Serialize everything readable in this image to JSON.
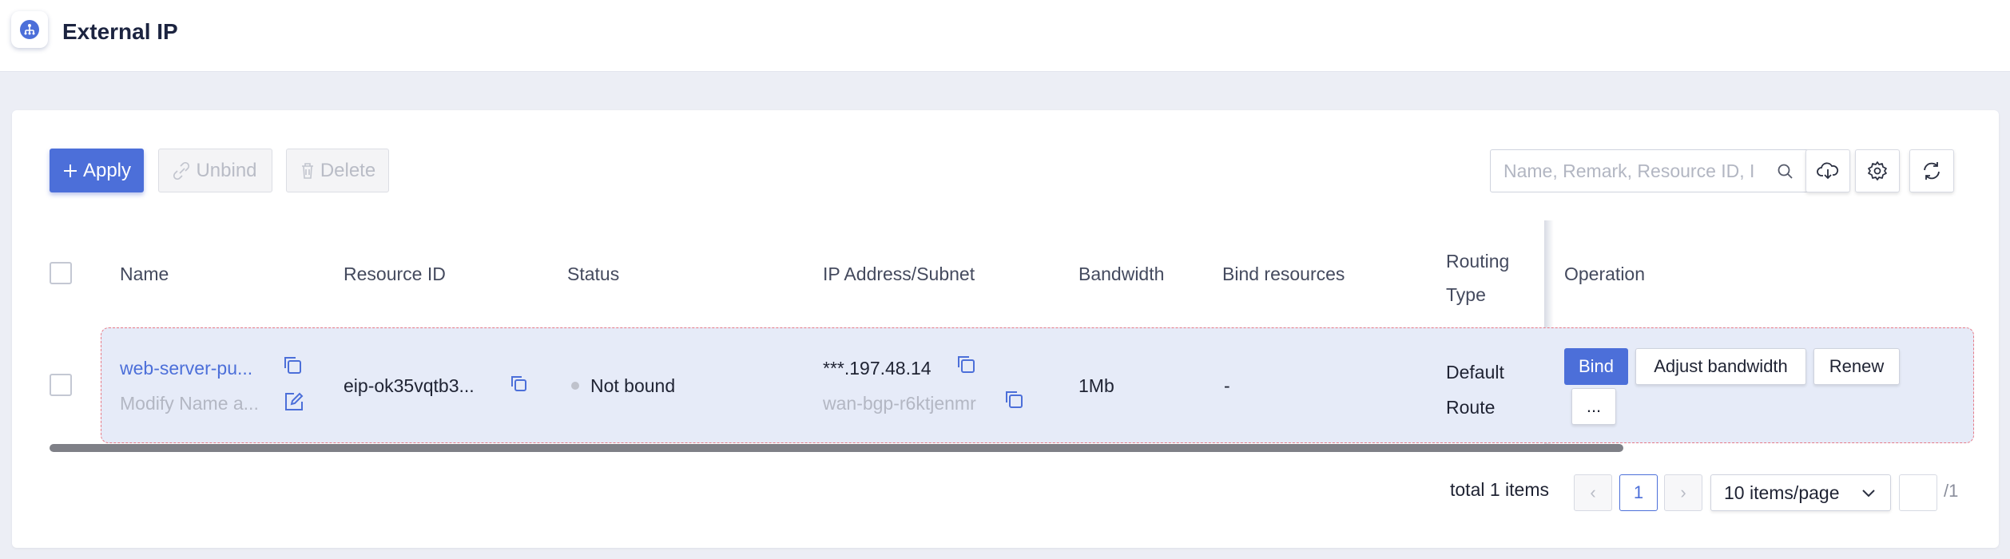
{
  "header": {
    "title": "External IP",
    "logo_icon": "network-icon"
  },
  "toolbar": {
    "apply_label": "Apply",
    "unbind_label": "Unbind",
    "delete_label": "Delete",
    "search_placeholder": "Name, Remark, Resource ID, I",
    "download_icon": "cloud-download-icon",
    "settings_icon": "gear-icon",
    "refresh_icon": "refresh-icon"
  },
  "table": {
    "columns": {
      "name": "Name",
      "resource_id": "Resource ID",
      "status": "Status",
      "ip": "IP Address/Subnet",
      "bandwidth": "Bandwidth",
      "bind": "Bind resources",
      "routing_line1": "Routing",
      "routing_line2": "Type",
      "operation": "Operation"
    },
    "rows": [
      {
        "name": "web-server-pu...",
        "remark": "Modify Name a...",
        "resource_id": "eip-ok35vqtb3...",
        "status": "Not bound",
        "ip": "***.197.48.14",
        "subnet": "wan-bgp-r6ktjenmr",
        "bandwidth": "1Mb",
        "bind_resources": "-",
        "routing_line1": "Default",
        "routing_line2": "Route",
        "ops": {
          "bind": "Bind",
          "adjust": "Adjust bandwidth",
          "renew": "Renew",
          "more": "..."
        }
      }
    ]
  },
  "pagination": {
    "total_text": "total 1 items",
    "prev": "‹",
    "current_page": "1",
    "next": "›",
    "page_size": "10 items/page",
    "total_pages": "/1"
  },
  "colors": {
    "accent": "#4c6fd9",
    "row_bg": "#e6ebf8",
    "row_border": "#e77a87"
  }
}
